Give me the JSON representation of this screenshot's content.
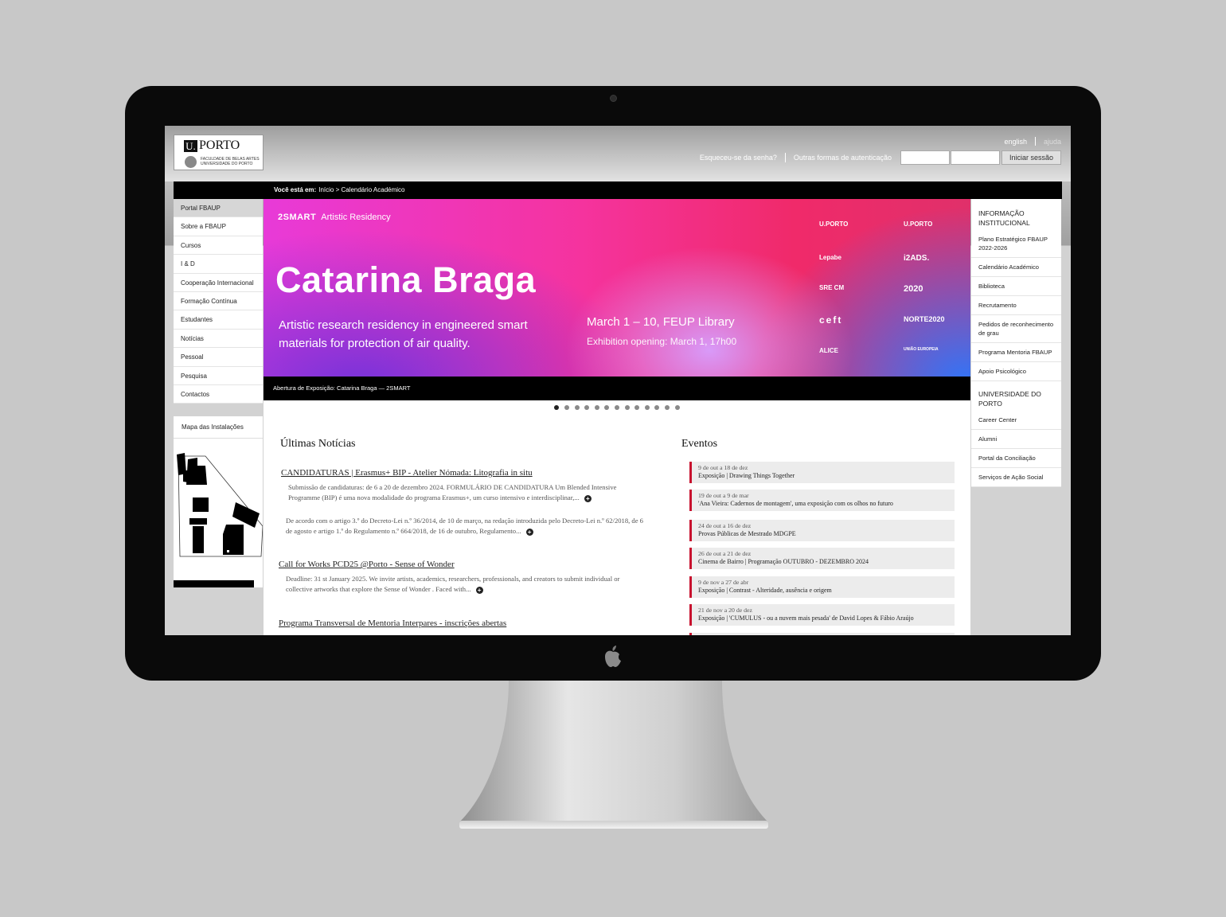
{
  "header": {
    "logo": {
      "mark": "U.",
      "name": "PORTO",
      "faculty_line1": "FACULDADE DE BELAS ARTES",
      "faculty_line2": "UNIVERSIDADE DO PORTO"
    },
    "lang": "english",
    "help": "ajuda",
    "forgot": "Esqueceu-se da senha?",
    "other_auth": "Outras formas de autenticação",
    "login_button": "Iniciar sessão"
  },
  "breadcrumb": {
    "label": "Você está em:",
    "path": "Início > Calendário Académico"
  },
  "left_nav": {
    "items": [
      "Portal FBAUP",
      "Sobre a FBAUP",
      "Cursos",
      "I & D",
      "Cooperação Internacional",
      "Formação Contínua",
      "Estudantes",
      "Notícias",
      "Pessoal",
      "Pesquisa",
      "Contactos"
    ],
    "map_title": "Mapa das Instalações"
  },
  "banner": {
    "brand_bold": "2SMART",
    "brand_rest": "Artistic Residency",
    "name": "Catarina Braga",
    "desc": "Artistic research residency in engineered smart materials for protection of air quality.",
    "dates": "March 1 – 10, FEUP Library",
    "opening": "Exhibition opening: March 1, 17h00",
    "partners": [
      "U.PORTO",
      "U.PORTO",
      "Lepabe",
      "i2ADS.",
      "SRE CM",
      "2020",
      "ceft",
      "NORTE2020",
      "ALICE",
      "UNIÃO EUROPEIA"
    ],
    "caption": "Abertura de Exposição: Catarina Braga — 2SMART",
    "slide_count": 13,
    "active_slide": 1
  },
  "news": {
    "heading": "Últimas Notícias",
    "items": [
      {
        "title": "CANDIDATURAS | Erasmus+ BIP - Atelier Nómada: Litografia in situ",
        "body": "Submissão de candidaturas: de 6 a 20 de dezembro 2024. FORMULÁRIO DE CANDIDATURA Um  Blended Intensive Programme (BIP)  é uma nova modalidade do programa Erasmus+, um curso intensivo e interdisciplinar,..."
      },
      {
        "title": "",
        "body": "De acordo com o artigo 3.º do Decreto-Lei n.º 36/2014, de 10 de março, na redação introduzida pelo Decreto-Lei n.º 62/2018, de 6 de agosto e artigo 1.º do Regulamento n.º 664/2018, de 16 de outubro, Regulamento..."
      },
      {
        "title": "Call for Works PCD25 @Porto - Sense of Wonder",
        "body": "Deadline: 31 st January 2025. We invite artists, academics, researchers, professionals, and creators to submit individual or collective artworks that explore the Sense of Wonder . Faced with..."
      },
      {
        "title": "Programa Transversal de Mentoria Interpares - inscrições abertas",
        "body": ""
      }
    ]
  },
  "events": {
    "heading": "Eventos",
    "items": [
      {
        "date": "9 de out a 18 de dez",
        "title": "Exposição | Drawing Things Together"
      },
      {
        "date": "19 de out a 9 de mar",
        "title": "'Ana Vieira: Cadernos de montagem', uma exposição com os olhos no futuro"
      },
      {
        "date": "24 de out a 16 de dez",
        "title": "Provas Públicas de Mestrado MDGPE"
      },
      {
        "date": "26 de out a 21 de dez",
        "title": "Cinema de Bairro | Programação OUTUBRO - DEZEMBRO 2024"
      },
      {
        "date": "9 de nov a 27 de abr",
        "title": "Exposição | Contrast - Alteridade, ausência e origem"
      },
      {
        "date": "21 de nov a 20 de dez",
        "title": "Exposição | 'CUMULUS - ou a nuvem mais pesada' de David Lopes & Fábio Araújo"
      }
    ]
  },
  "right_nav": {
    "section1": "INFORMAÇÃO INSTITUCIONAL",
    "items1": [
      "Plano Estratégico FBAUP 2022-2026",
      "Calendário Académico",
      "Biblioteca",
      "Recrutamento",
      "Pedidos de reconhecimento de grau",
      "Programa Mentoria FBAUP",
      "Apoio Psicológico"
    ],
    "section2": "UNIVERSIDADE DO PORTO",
    "items2": [
      "Career Center",
      "Alumni",
      "Portal da Conciliação",
      "Serviços de Ação Social"
    ]
  },
  "colors": {
    "accent": "#c8102e",
    "banner_pink": "#f5339e",
    "banner_blue": "#2878ff"
  }
}
